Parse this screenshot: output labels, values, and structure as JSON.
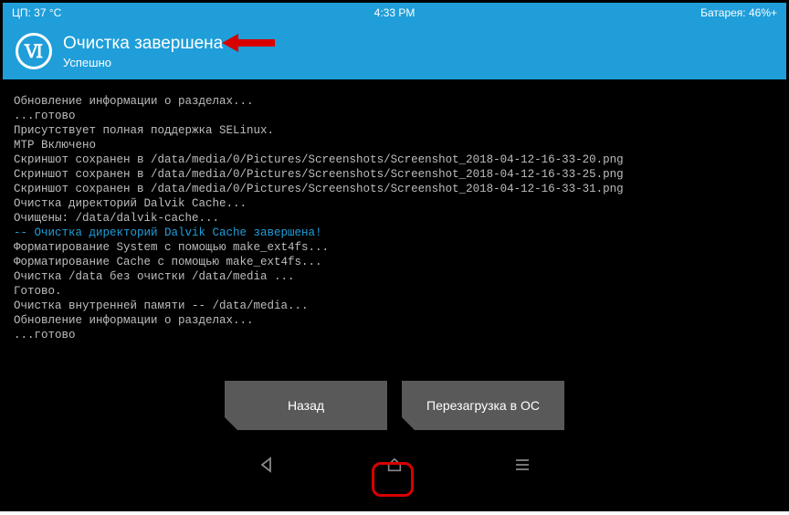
{
  "statusbar": {
    "left": "ЦП: 37 °C",
    "center": "4:33 PM",
    "right": "Батарея: 46%+"
  },
  "header": {
    "title": "Очистка завершена",
    "subtitle": "Успешно",
    "logo_glyph": "Ⅵ"
  },
  "console_lines": [
    {
      "t": "Обновление информации о разделах...",
      "hl": false
    },
    {
      "t": "...готово",
      "hl": false
    },
    {
      "t": "Присутствует полная поддержка SELinux.",
      "hl": false
    },
    {
      "t": "MTP Включено",
      "hl": false
    },
    {
      "t": "Скриншот сохранен в /data/media/0/Pictures/Screenshots/Screenshot_2018-04-12-16-33-20.png",
      "hl": false
    },
    {
      "t": "Скриншот сохранен в /data/media/0/Pictures/Screenshots/Screenshot_2018-04-12-16-33-25.png",
      "hl": false
    },
    {
      "t": "Скриншот сохранен в /data/media/0/Pictures/Screenshots/Screenshot_2018-04-12-16-33-31.png",
      "hl": false
    },
    {
      "t": "Очистка директорий Dalvik Cache...",
      "hl": false
    },
    {
      "t": "Очищены: /data/dalvik-cache...",
      "hl": false
    },
    {
      "t": "-- Очистка директорий Dalvik Cache завершена!",
      "hl": true
    },
    {
      "t": "Форматирование System с помощью make_ext4fs...",
      "hl": false
    },
    {
      "t": "Форматирование Cache с помощью make_ext4fs...",
      "hl": false
    },
    {
      "t": "Очистка /data без очистки /data/media ...",
      "hl": false
    },
    {
      "t": "Готово.",
      "hl": false
    },
    {
      "t": "Очистка внутренней памяти -- /data/media...",
      "hl": false
    },
    {
      "t": "Обновление информации о разделах...",
      "hl": false
    },
    {
      "t": "...готово",
      "hl": false
    }
  ],
  "buttons": {
    "back": "Назад",
    "reboot": "Перезагрузка в ОС"
  }
}
